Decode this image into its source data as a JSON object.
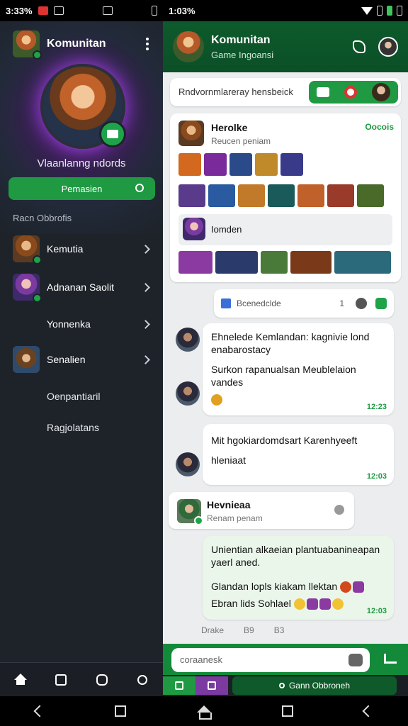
{
  "status_bar": {
    "left_time": "3:33%",
    "right_time": "1:03%",
    "colors": {
      "alert": "#dd3333",
      "battery_ok": "#3fc45e"
    }
  },
  "drawer": {
    "title": "Komunitan",
    "profile_name": "Vlaanlanng ndords",
    "primary_button": "Pemasien",
    "section_label": "Racn Obbrofis",
    "items": [
      {
        "label": "Kemutia",
        "avatar": "orange",
        "chevron": true
      },
      {
        "label": "Adnanan Saolit",
        "avatar": "purple",
        "chevron": true
      },
      {
        "label": "Yonnenka",
        "avatar": "",
        "chevron": true
      },
      {
        "label": "Senalien",
        "avatar": "cowboy",
        "chevron": true
      },
      {
        "label": "Oenpantiaril",
        "avatar": "",
        "chevron": false
      },
      {
        "label": "Ragjolatans",
        "avatar": "",
        "chevron": false
      }
    ],
    "bottom_nav": [
      "home-icon",
      "camera-icon",
      "sticker-icon",
      "search-icon"
    ]
  },
  "chat": {
    "header": {
      "title": "Komunitan",
      "subtitle": "Game Ingoansi"
    },
    "search_card": {
      "placeholder": "Rndvornmlareray hensbeick"
    },
    "game_card": {
      "title": "Herolke",
      "subtitle": "Reucen peniam",
      "status": "Oocois",
      "sub_card_text": "Iomden"
    },
    "reaction_card": {
      "text": "Bcenedclde",
      "count": "1"
    },
    "messages": [
      {
        "line1": "Ehnelede Kemlandan: kagnivie lond",
        "line2": "enabarostacy",
        "line3": "Surkon rapanualsan Meublelaion",
        "line4": "vandes",
        "time": "12:23"
      },
      {
        "line1": "Mit hgokiardomdsart Karenhyeeft",
        "line2": "hleniaat",
        "time": "12:03"
      }
    ],
    "user_card": {
      "name": "Hevnieaa",
      "sub": "Renam penam"
    },
    "green_bubble": {
      "line1": "Unientian alkaeian plantuabanineapan",
      "line2": "yaerl aned.",
      "line3": "Glandan lopls kiakam llektan",
      "line4": "Ebran lids Sohlael",
      "time": "12:03"
    },
    "meta": [
      "Drake",
      "B9",
      "B3"
    ],
    "composer": {
      "placeholder": "coraanesk",
      "game_button": "Gann Obbroneh"
    }
  },
  "accent": "#1f9a43"
}
